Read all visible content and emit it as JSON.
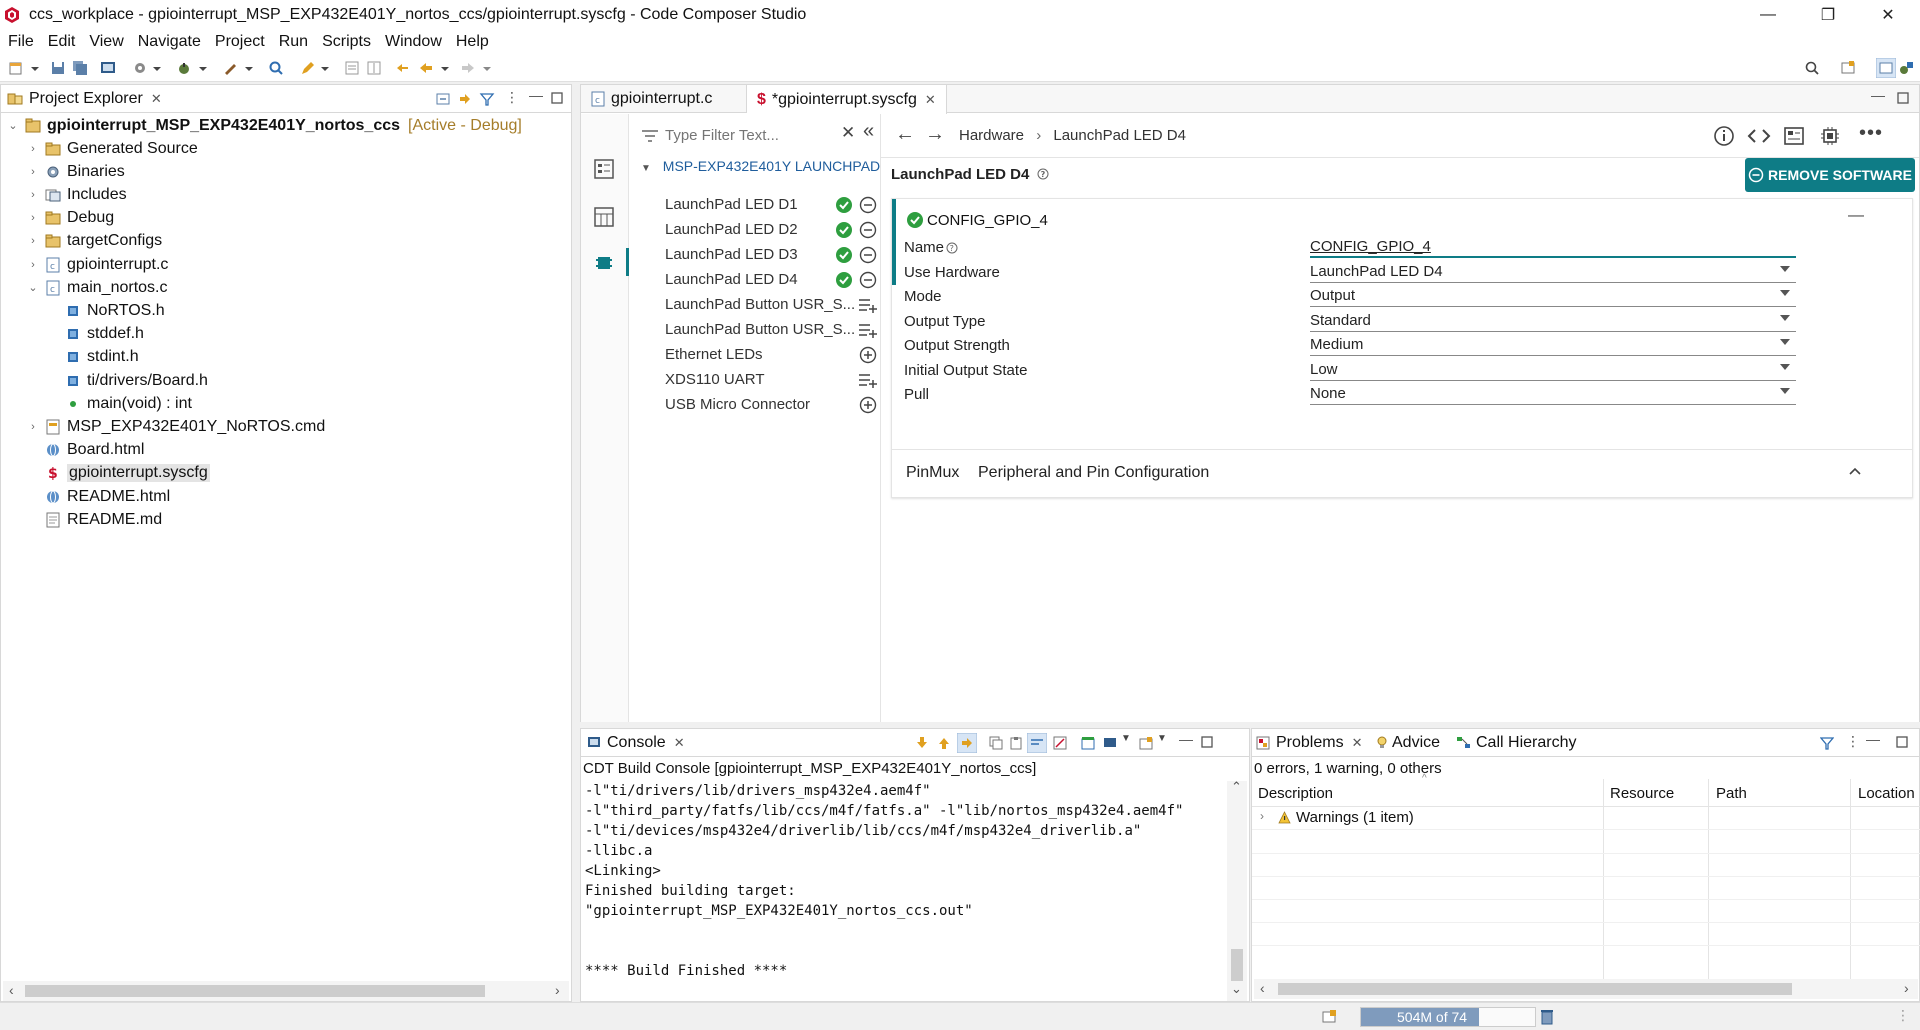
{
  "window": {
    "title": "ccs_workplace - gpiointerrupt_MSP_EXP432E401Y_nortos_ccs/gpiointerrupt.syscfg - Code Composer Studio",
    "min": "—",
    "restore": "❐",
    "close": "✕"
  },
  "menu": [
    "File",
    "Edit",
    "View",
    "Navigate",
    "Project",
    "Run",
    "Scripts",
    "Window",
    "Help"
  ],
  "project_explorer": {
    "tab": "Project Explorer",
    "root": "gpiointerrupt_MSP_EXP432E401Y_nortos_ccs",
    "root_status": "[Active - Debug]",
    "items": [
      {
        "label": "Generated Source",
        "icon": "folder-icon",
        "indent": 1,
        "chev": "›"
      },
      {
        "label": "Binaries",
        "icon": "binaries-icon",
        "indent": 1,
        "chev": "›"
      },
      {
        "label": "Includes",
        "icon": "includes-icon",
        "indent": 1,
        "chev": "›"
      },
      {
        "label": "Debug",
        "icon": "folder-icon",
        "indent": 1,
        "chev": "›"
      },
      {
        "label": "targetConfigs",
        "icon": "folder-icon",
        "indent": 1,
        "chev": "›"
      },
      {
        "label": "gpiointerrupt.c",
        "icon": "c-file-icon",
        "indent": 1,
        "chev": "›"
      },
      {
        "label": "main_nortos.c",
        "icon": "c-file-icon",
        "indent": 1,
        "chev": "⌄"
      },
      {
        "label": "NoRTOS.h",
        "icon": "header-icon",
        "indent": 2,
        "chev": ""
      },
      {
        "label": "stddef.h",
        "icon": "header-icon",
        "indent": 2,
        "chev": ""
      },
      {
        "label": "stdint.h",
        "icon": "header-icon",
        "indent": 2,
        "chev": ""
      },
      {
        "label": "ti/drivers/Board.h",
        "icon": "header-icon",
        "indent": 2,
        "chev": ""
      },
      {
        "label": "main(void) : int",
        "icon": "function-icon",
        "indent": 2,
        "chev": ""
      },
      {
        "label": "MSP_EXP432E401Y_NoRTOS.cmd",
        "icon": "cmd-file-icon",
        "indent": 1,
        "chev": "›"
      },
      {
        "label": "Board.html",
        "icon": "html-file-icon",
        "indent": 1,
        "chev": ""
      },
      {
        "label": "gpiointerrupt.syscfg",
        "icon": "syscfg-file-icon",
        "indent": 1,
        "chev": "",
        "selected": true
      },
      {
        "label": "README.html",
        "icon": "html-file-icon",
        "indent": 1,
        "chev": ""
      },
      {
        "label": "README.md",
        "icon": "md-file-icon",
        "indent": 1,
        "chev": ""
      }
    ]
  },
  "editor": {
    "tabs": [
      {
        "label": "gpiointerrupt.c",
        "active": false
      },
      {
        "label": "*gpiointerrupt.syscfg",
        "active": true
      }
    ],
    "filter_placeholder": "Type Filter Text...",
    "group": "MSP-EXP432E401Y LAUNCHPAD...",
    "hw_items": [
      {
        "label": "LaunchPad LED D1",
        "state": "added"
      },
      {
        "label": "LaunchPad LED D2",
        "state": "added"
      },
      {
        "label": "LaunchPad LED D3",
        "state": "added"
      },
      {
        "label": "LaunchPad LED D4",
        "state": "added"
      },
      {
        "label": "LaunchPad Button USR_S...",
        "state": "list"
      },
      {
        "label": "LaunchPad Button USR_S...",
        "state": "list"
      },
      {
        "label": "Ethernet LEDs",
        "state": "add"
      },
      {
        "label": "XDS110 UART",
        "state": "list"
      },
      {
        "label": "USB Micro Connector",
        "state": "add"
      }
    ],
    "breadcrumb": [
      "Hardware",
      "LaunchPad LED D4"
    ],
    "breadcrumb_sep": "›",
    "section_title": "LaunchPad LED D4",
    "remove_button": "REMOVE SOFTWARE",
    "config_name": "CONFIG_GPIO_4",
    "collapse_symbol": "—",
    "fields": [
      {
        "label": "Name",
        "value": "CONFIG_GPIO_4",
        "kind": "text",
        "help": true
      },
      {
        "label": "Use Hardware",
        "value": "LaunchPad LED D4",
        "kind": "select"
      },
      {
        "label": "Mode",
        "value": "Output",
        "kind": "select"
      },
      {
        "label": "Output Type",
        "value": "Standard",
        "kind": "select"
      },
      {
        "label": "Output Strength",
        "value": "Medium",
        "kind": "select"
      },
      {
        "label": "Initial Output State",
        "value": "Low",
        "kind": "select"
      },
      {
        "label": "Pull",
        "value": "None",
        "kind": "select"
      }
    ],
    "pinmux_label": "PinMux",
    "pinmux_title": "Peripheral and Pin Configuration"
  },
  "console": {
    "tab": "Console",
    "header": "CDT Build Console [gpiointerrupt_MSP_EXP432E401Y_nortos_ccs]",
    "lines": [
      "-l\"ti/drivers/lib/drivers_msp432e4.aem4f\"",
      "-l\"third_party/fatfs/lib/ccs/m4f/fatfs.a\" -l\"lib/nortos_msp432e4.aem4f\"",
      "-l\"ti/devices/msp432e4/driverlib/lib/ccs/m4f/msp432e4_driverlib.a\"",
      "-llibc.a",
      "<Linking>",
      "Finished building target:",
      "\"gpiointerrupt_MSP_EXP432E401Y_nortos_ccs.out\"",
      "",
      "",
      "**** Build Finished ****"
    ]
  },
  "problems": {
    "tabs": [
      "Problems",
      "Advice",
      "Call Hierarchy"
    ],
    "summary": "0 errors, 1 warning, 0 others",
    "columns": [
      "Description",
      "Resource",
      "Path",
      "Location"
    ],
    "rows": [
      {
        "label": "Warnings (1 item)"
      }
    ]
  },
  "status": {
    "memory": "504M of 74",
    "memory_used_fraction": 0.68
  },
  "colors": {
    "accent": "#0e7c86",
    "check": "#2e9e3f",
    "link": "#1f5d9c",
    "active_status": "#a57d2a"
  }
}
